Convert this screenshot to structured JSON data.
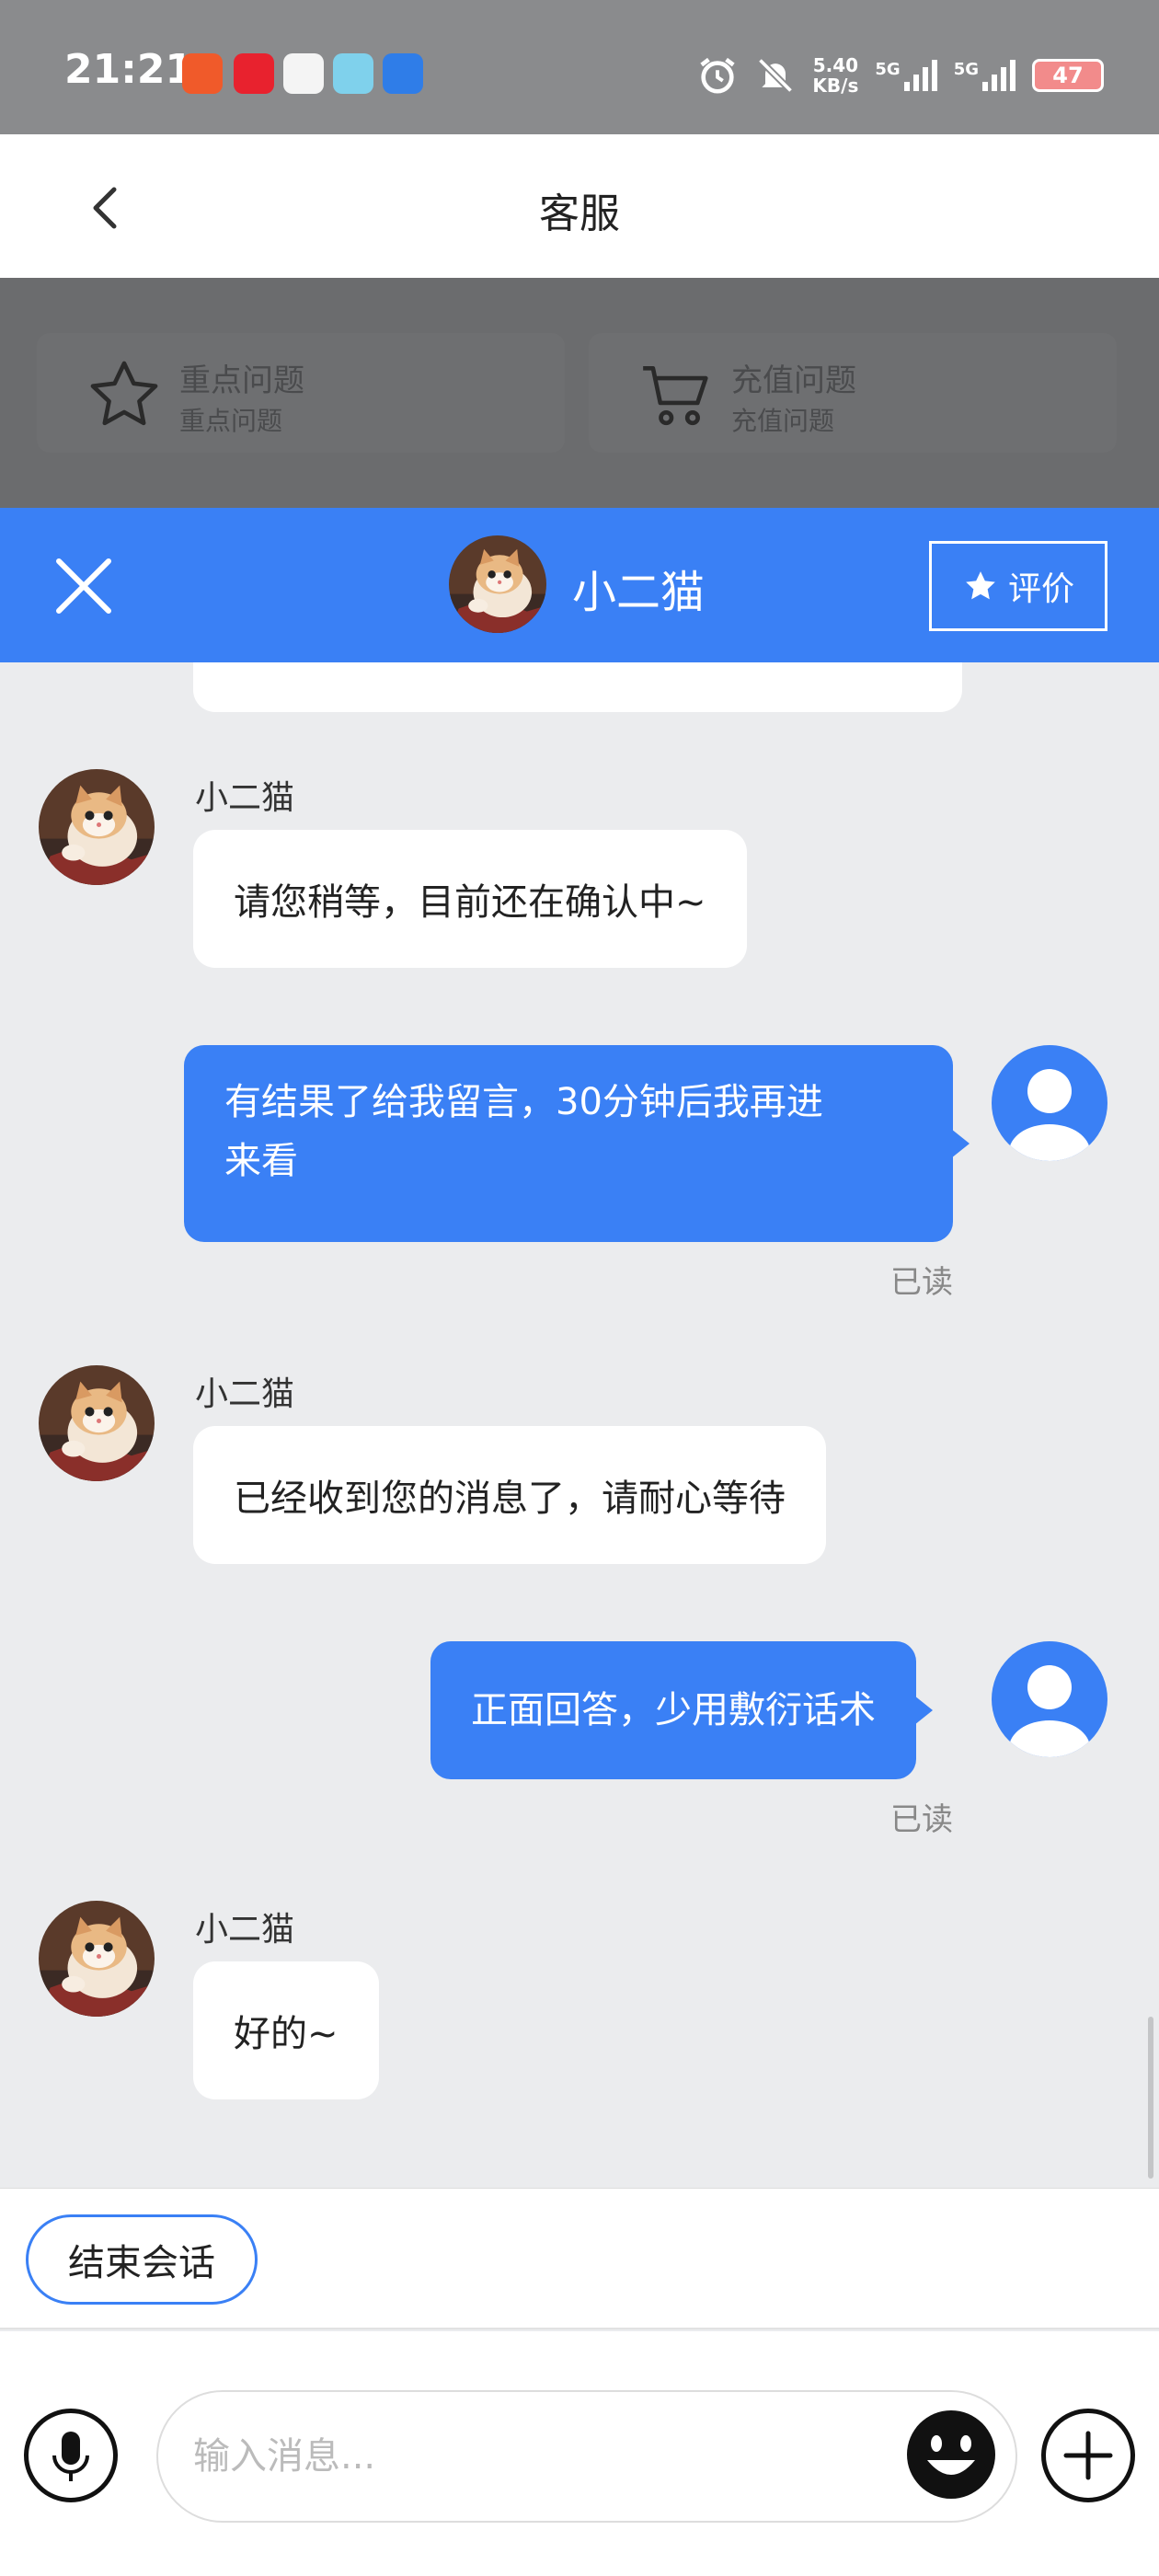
{
  "status_bar": {
    "time": "21:21",
    "net_speed_value": "5.40",
    "net_speed_unit": "KB/s",
    "signal1_label": "5G",
    "signal2_label": "5G",
    "battery": "47"
  },
  "nav": {
    "title": "客服"
  },
  "shortcuts": [
    {
      "title": "重点问题",
      "subtitle": "重点问题",
      "icon": "star-outline-icon"
    },
    {
      "title": "充值问题",
      "subtitle": "充值问题",
      "icon": "cart-icon"
    }
  ],
  "chat_header": {
    "agent_name": "小二猫",
    "rate_label": "评价"
  },
  "messages": [
    {
      "from": "agent",
      "sender": "小二猫",
      "text": "请您稍等，目前还在确认中~"
    },
    {
      "from": "user",
      "line1": "有结果了给我留言，30分钟后我再进",
      "line2": "来看",
      "status": "已读"
    },
    {
      "from": "agent",
      "sender": "小二猫",
      "text": "已经收到您的消息了，请耐心等待"
    },
    {
      "from": "user",
      "text": "正面回答，少用敷衍话术",
      "status": "已读"
    },
    {
      "from": "agent",
      "sender": "小二猫",
      "text": "好的~"
    }
  ],
  "end_session_label": "结束会话",
  "input": {
    "placeholder": "输入消息..."
  },
  "colors": {
    "accent": "#3a80f5",
    "chat_bg": "#ebecee"
  }
}
